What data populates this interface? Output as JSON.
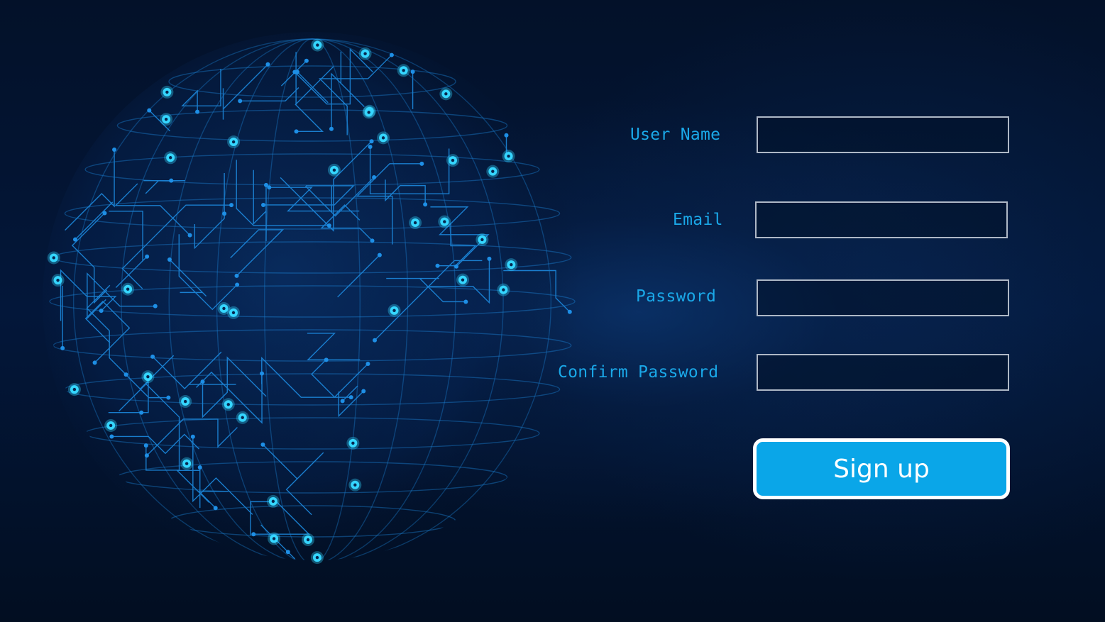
{
  "form": {
    "fields": [
      {
        "label": "User Name",
        "value": "",
        "placeholder": ""
      },
      {
        "label": "Email",
        "value": "",
        "placeholder": ""
      },
      {
        "label": "Password",
        "value": "",
        "placeholder": ""
      },
      {
        "label": "Confirm Password",
        "value": "",
        "placeholder": ""
      }
    ],
    "submit_label": "Sign up"
  },
  "colors": {
    "background": "#031129",
    "label_text": "#1aa8e8",
    "input_border": "#aeb8c6",
    "button_fill": "#0aa6e8",
    "button_border": "#ffffff",
    "globe_lines": "#1e8fe6",
    "globe_nodes": "#35d6ff"
  },
  "decor": {
    "globe": "network-globe-illustration"
  }
}
